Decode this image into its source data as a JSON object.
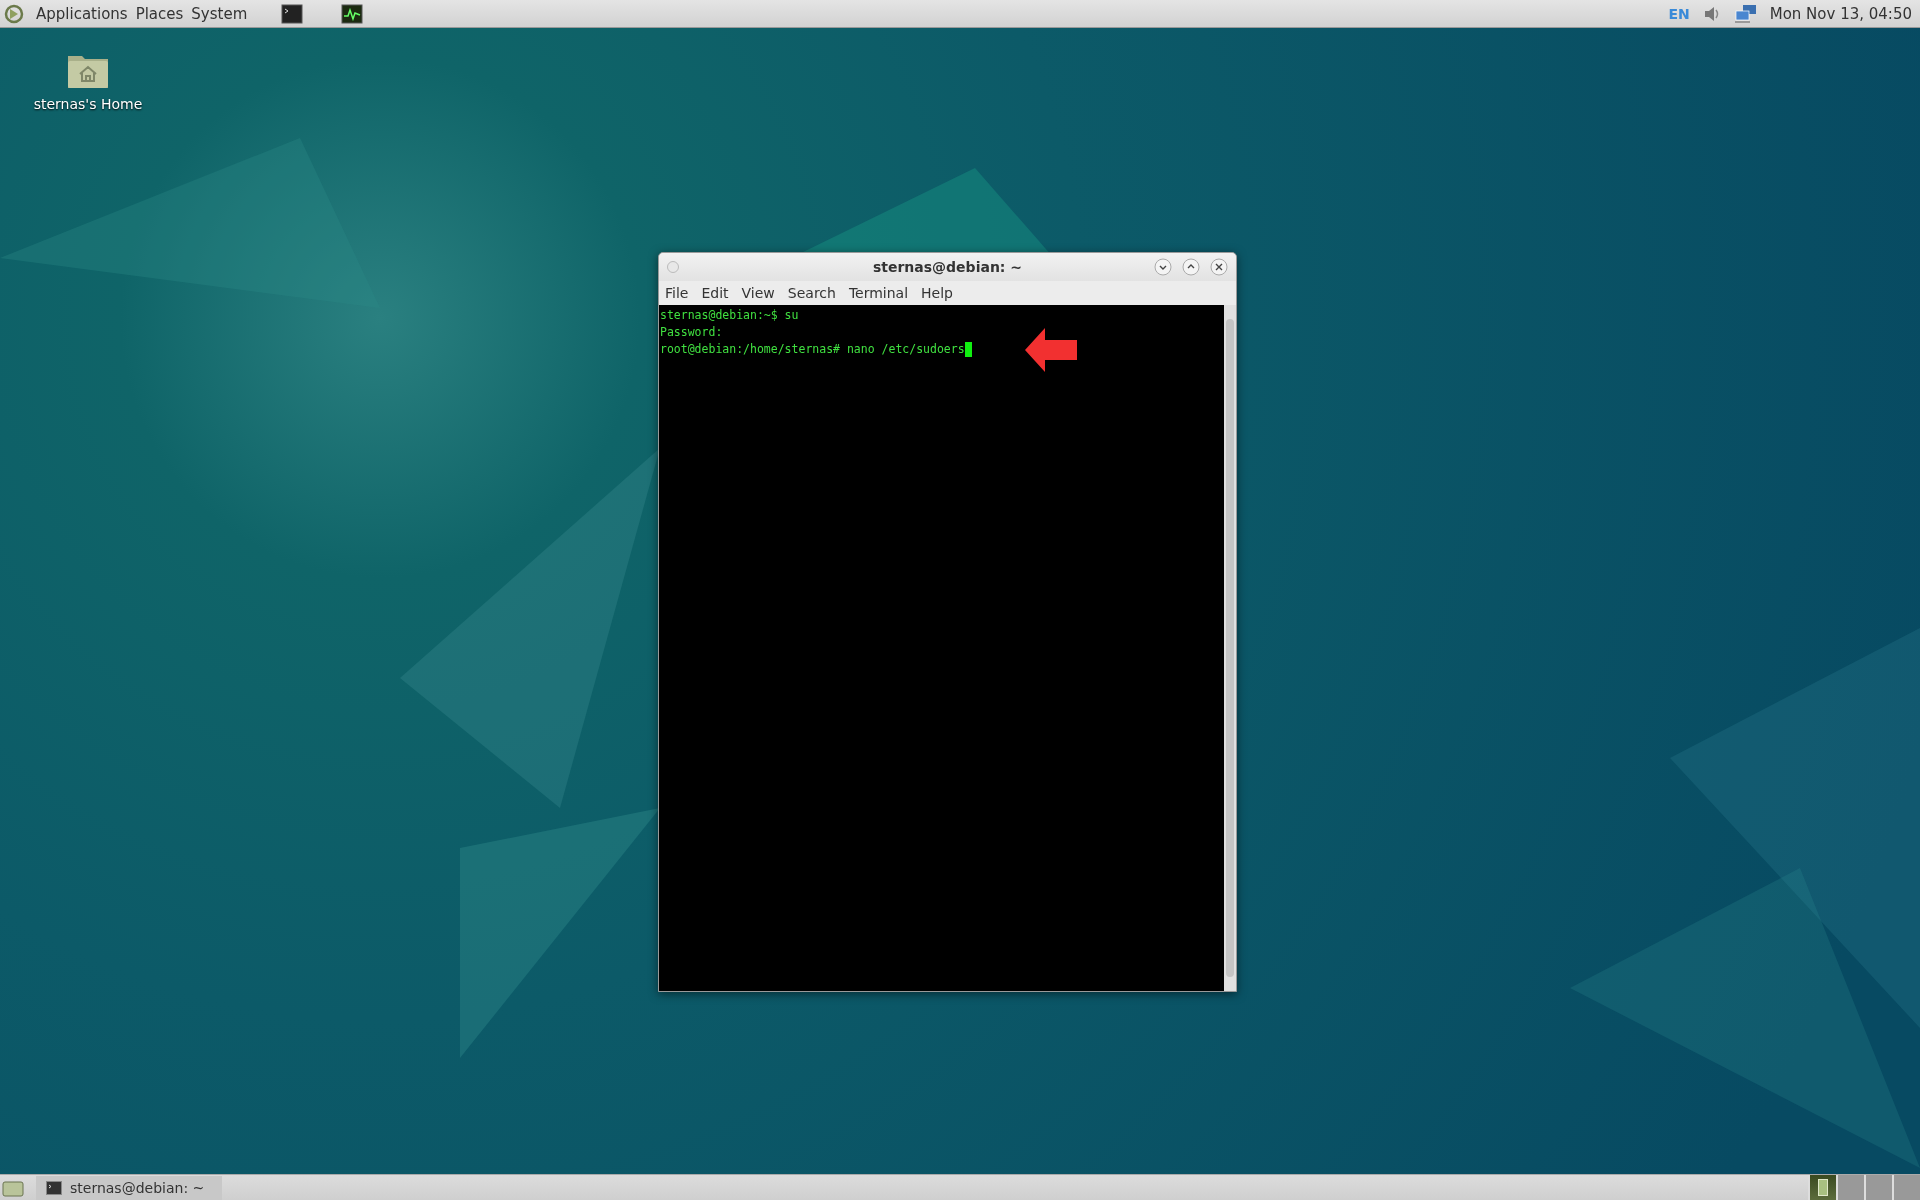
{
  "top_panel": {
    "menus": [
      "Applications",
      "Places",
      "System"
    ],
    "keyboard_layout": "EN",
    "clock": "Mon Nov 13, 04:50"
  },
  "desktop_icons": [
    {
      "label": "sternas's Home"
    }
  ],
  "terminal_window": {
    "title": "sternas@debian: ~",
    "menu": [
      "File",
      "Edit",
      "View",
      "Search",
      "Terminal",
      "Help"
    ],
    "lines": [
      "sternas@debian:~$ su",
      "Password:",
      "root@debian:/home/sternas# nano /etc/sudoers"
    ]
  },
  "taskbar": {
    "tasks": [
      {
        "label": "sternas@debian: ~",
        "selected": false
      }
    ],
    "workspaces": [
      {
        "selected": true
      },
      {
        "selected": false
      },
      {
        "selected": false
      },
      {
        "selected": false
      }
    ]
  }
}
